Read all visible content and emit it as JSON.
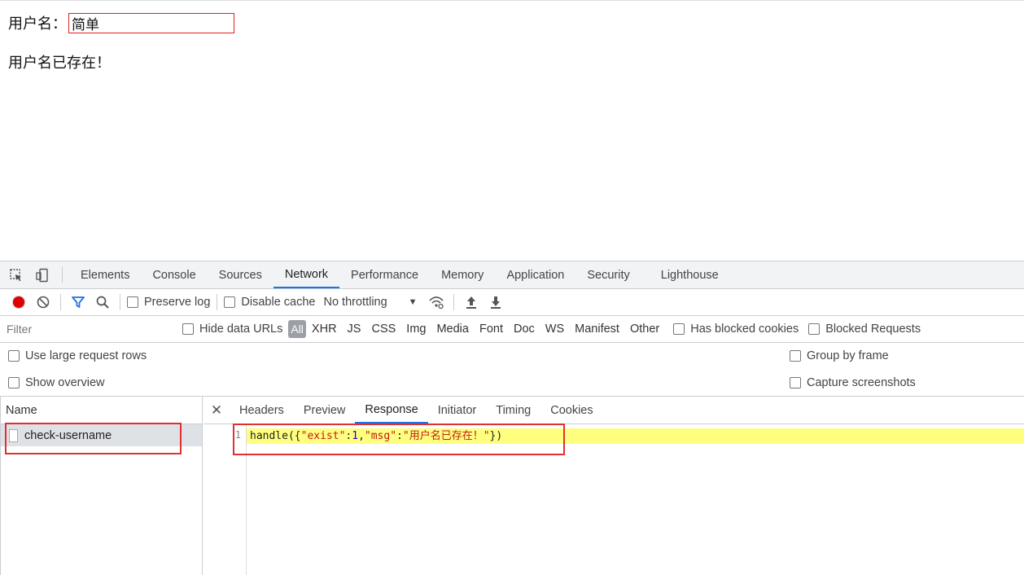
{
  "page": {
    "username_label": "用户名：",
    "username_value": "简单",
    "result_message": "用户名已存在！"
  },
  "devtools": {
    "tabs": [
      "Elements",
      "Console",
      "Sources",
      "Network",
      "Performance",
      "Memory",
      "Application",
      "Security",
      "Lighthouse"
    ],
    "active_tab": "Network",
    "toolbar": {
      "preserve_log": "Preserve log",
      "disable_cache": "Disable cache",
      "throttling": "No throttling"
    },
    "filter": {
      "placeholder": "Filter",
      "hide_data_urls": "Hide data URLs",
      "types": [
        "All",
        "XHR",
        "JS",
        "CSS",
        "Img",
        "Media",
        "Font",
        "Doc",
        "WS",
        "Manifest",
        "Other"
      ],
      "has_blocked_cookies": "Has blocked cookies",
      "blocked_requests": "Blocked Requests"
    },
    "options": {
      "large_rows": "Use large request rows",
      "show_overview": "Show overview",
      "group_by_frame": "Group by frame",
      "capture_screenshots": "Capture screenshots"
    },
    "requests": {
      "header": "Name",
      "items": [
        "check-username"
      ]
    },
    "detail_tabs": [
      "Headers",
      "Preview",
      "Response",
      "Initiator",
      "Timing",
      "Cookies"
    ],
    "active_detail_tab": "Response",
    "response": {
      "line_number": "1",
      "fn": "handle",
      "open": "({",
      "key1": "\"exist\"",
      "colon": ":",
      "val1": "1",
      "comma": ",",
      "key2": "\"msg\"",
      "val2": "\"用户名已存在！\"",
      "close": "})"
    },
    "colors": {
      "accent": "#1a73e8",
      "record": "#e00000",
      "annotation": "#e03030",
      "highlight": "#ffff7f"
    }
  }
}
